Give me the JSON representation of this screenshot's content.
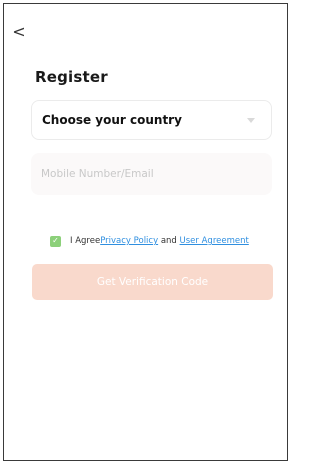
{
  "nav": {
    "back_icon": "chevron-left-icon",
    "back_glyph": "<"
  },
  "page": {
    "title": "Register"
  },
  "form": {
    "country_label": "Choose your country",
    "mobile_placeholder": "Mobile Number/Email",
    "agree": {
      "checked": true,
      "prefix": "I Agree",
      "privacy_link": "Privacy Policy",
      "conjunction": " and ",
      "user_link": "User Agreement"
    },
    "submit_label": "Get Verification Code"
  },
  "colors": {
    "accent_disabled": "#f9d9cc",
    "checkbox": "#8cd07a",
    "link": "#2f8fe0"
  }
}
